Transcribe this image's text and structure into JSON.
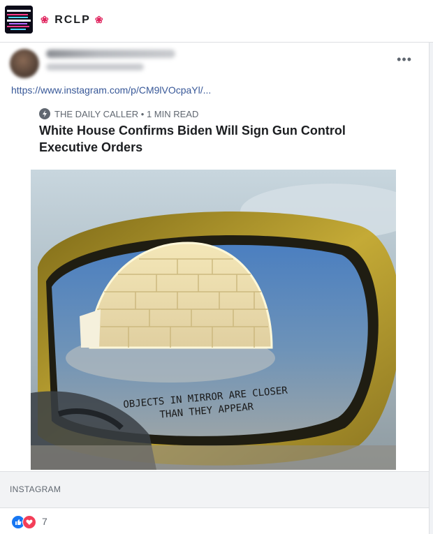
{
  "group": {
    "name": "RCLP",
    "flower_left": "❀",
    "flower_right": "❀"
  },
  "post": {
    "more_label": "•••",
    "link": "https://www.instagram.com/p/CM9lVOcpaYl/...",
    "card": {
      "source": "THE DAILY CALLER • 1 MIN READ",
      "title": "White House Confirms Biden Will Sign Gun Control Executive Orders",
      "image_caption_line1": "OBJECTS IN MIRROR ARE CLOSER",
      "image_caption_line2": "THAN THEY APPEAR",
      "domain": "INSTAGRAM"
    },
    "reactions": {
      "count": "7",
      "icons": [
        "like-icon",
        "love-icon"
      ]
    }
  },
  "colors": {
    "link": "#385898",
    "like": "#1877f2",
    "love": "#f33e58",
    "mirror_frame": "#b39a2a"
  }
}
